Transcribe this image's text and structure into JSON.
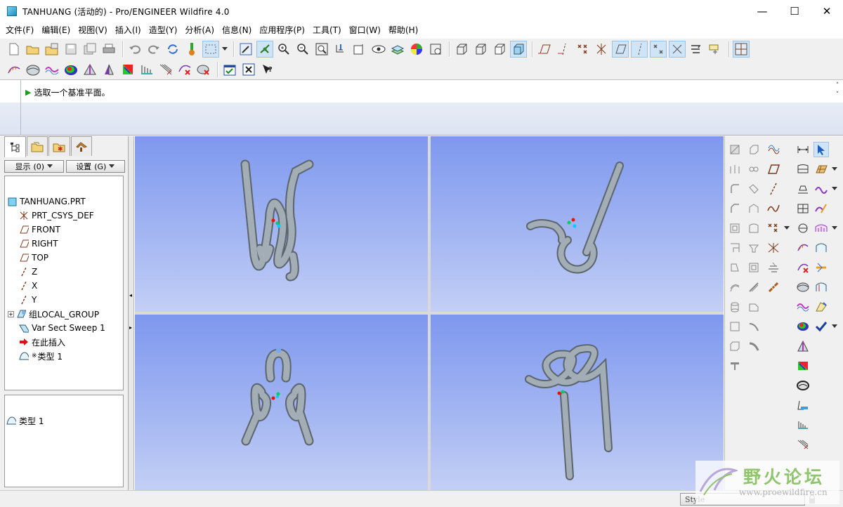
{
  "window": {
    "title": "TANHUANG (活动的) - Pro/ENGINEER Wildfire 4.0",
    "minimize": "—",
    "maximize": "☐",
    "close": "✕"
  },
  "menus": [
    "文件(F)",
    "编辑(E)",
    "视图(V)",
    "插入(I)",
    "造型(Y)",
    "分析(A)",
    "信息(N)",
    "应用程序(P)",
    "工具(T)",
    "窗口(W)",
    "帮助(H)"
  ],
  "message": {
    "text": "选取一个基准平面。",
    "arrow": "▶"
  },
  "left_panel": {
    "filter_show": "显示",
    "filter_show_key": "(0)",
    "filter_settings": "设置",
    "filter_settings_key": "(G)",
    "tree": [
      {
        "label": "TANHUANG.PRT",
        "icon": "part-icon"
      },
      {
        "label": "PRT_CSYS_DEF",
        "icon": "csys-icon"
      },
      {
        "label": "FRONT",
        "icon": "datum-plane-icon"
      },
      {
        "label": "RIGHT",
        "icon": "datum-plane-icon"
      },
      {
        "label": "TOP",
        "icon": "datum-plane-icon"
      },
      {
        "label": "Z",
        "icon": "axis-icon"
      },
      {
        "label": "X",
        "icon": "axis-icon"
      },
      {
        "label": "Y",
        "icon": "axis-icon"
      },
      {
        "label": "组LOCAL_GROUP",
        "icon": "group-icon"
      },
      {
        "label": "Var Sect Sweep 1",
        "icon": "sweep-icon"
      },
      {
        "label": "在此插入",
        "icon": "insert-here-icon"
      },
      {
        "label": "类型 1",
        "icon": "style-feature-icon"
      }
    ],
    "tree_expander": "+",
    "style_marker": "※",
    "properties_item": "类型 1"
  },
  "status": {
    "style_label": "Style"
  },
  "watermark": {
    "cn": "野火论坛",
    "url": "www.proewildfire.cn"
  },
  "colors": {
    "viewport_top": "#7e98ee",
    "viewport_bottom": "#c3cff5",
    "wire": "#9aa4ad",
    "accent": "#1a8fc0"
  }
}
